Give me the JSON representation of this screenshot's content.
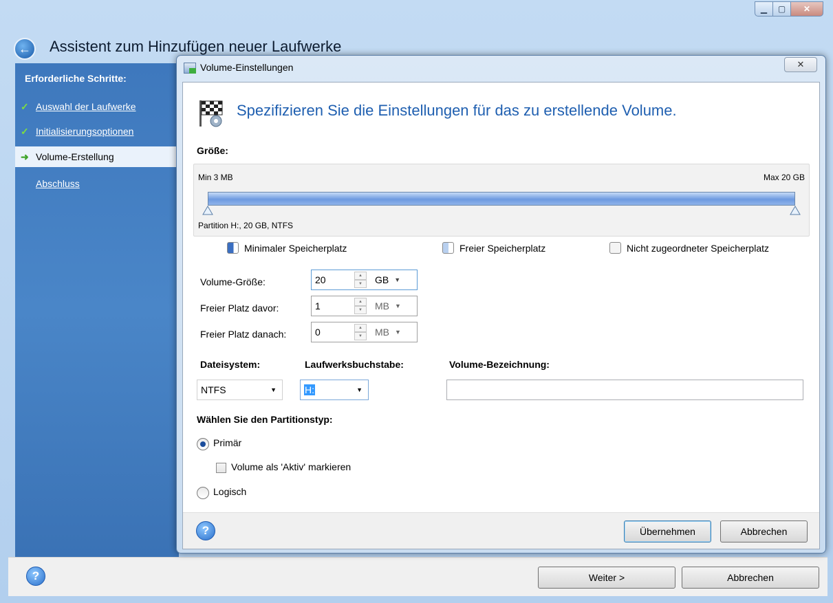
{
  "window": {
    "title": "Assistent zum Hinzufügen neuer Laufwerke",
    "caption_buttons": [
      "minimize-icon",
      "maximize-icon",
      "close-icon"
    ]
  },
  "sidebar": {
    "heading": "Erforderliche Schritte:",
    "steps": [
      {
        "label": "Auswahl der Laufwerke",
        "state": "done"
      },
      {
        "label": "Initialisierungsoptionen",
        "state": "done"
      },
      {
        "label": "Volume-Erstellung",
        "state": "current"
      },
      {
        "label": "Abschluss",
        "state": "pending"
      }
    ]
  },
  "bottom": {
    "help_icon": "?",
    "next_label": "Weiter >",
    "cancel_label": "Abbrechen"
  },
  "dialog": {
    "title": "Volume-Einstellungen",
    "heading": "Spezifizieren Sie die Einstellungen für das zu erstellende Volume.",
    "size_label": "Größe:",
    "size_min": "Min 3 MB",
    "size_max": "Max 20 GB",
    "size_fill_fraction": 1.0,
    "partition_caption": "Partition H:, 20 GB, NTFS",
    "legend": {
      "min_space": "Minimaler Speicherplatz",
      "free_space": "Freier Speicherplatz",
      "unallocated": "Nicht zugeordneter Speicherplatz"
    },
    "fields": {
      "volume_size": {
        "label": "Volume-Größe:",
        "value": "20",
        "unit": "GB"
      },
      "free_before": {
        "label": "Freier Platz davor:",
        "value": "1",
        "unit": "MB"
      },
      "free_after": {
        "label": "Freier Platz danach:",
        "value": "0",
        "unit": "MB"
      }
    },
    "filesystem": {
      "label": "Dateisystem:",
      "value": "NTFS"
    },
    "drive_letter": {
      "label": "Laufwerksbuchstabe:",
      "value": "H:"
    },
    "volume_label": {
      "label": "Volume-Bezeichnung:",
      "value": ""
    },
    "partition_type": {
      "label": "Wählen Sie den Partitionstyp:",
      "primary": "Primär",
      "active": "Volume als 'Aktiv' markieren",
      "logical": "Logisch",
      "selected": "primary",
      "active_checked": false
    },
    "apply_label": "Übernehmen",
    "cancel_label": "Abbrechen"
  },
  "colors": {
    "sidebar_bg": "#4a86c8",
    "heading_blue": "#1f5fb0",
    "slider_fill": "#6e9ae0",
    "legend_min": "#3b6fc1",
    "legend_free": "#b9d0ef",
    "legend_unalloc": "#f4f4f4"
  }
}
